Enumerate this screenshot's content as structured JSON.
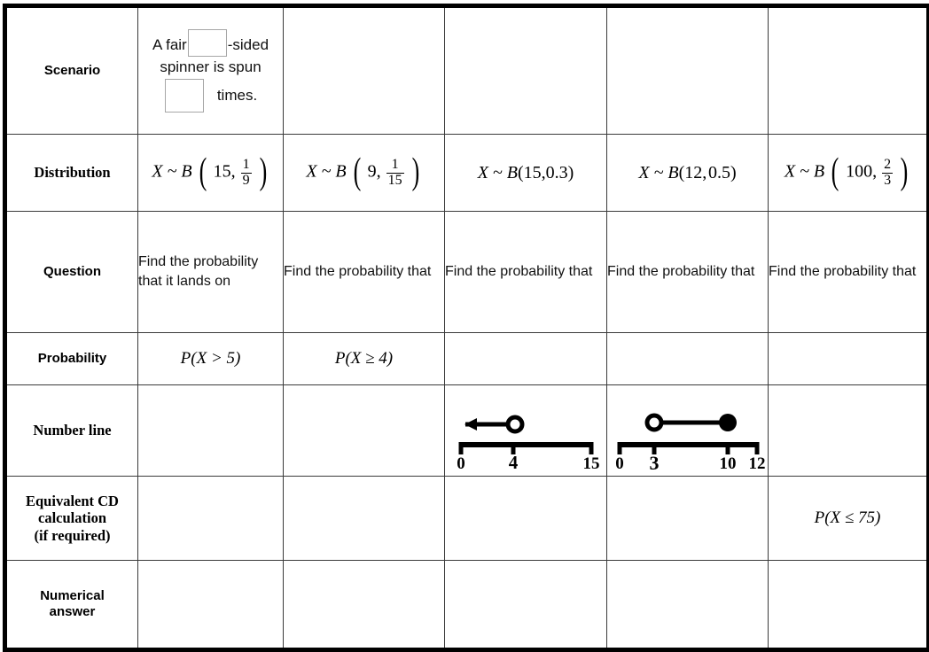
{
  "worksheet": {
    "row_headers": [
      "Scenario",
      "Distribution",
      "Question",
      "Probability",
      "Number line",
      "Equivalent CD calculation (if required)",
      "Numerical answer"
    ],
    "row_header_lines": {
      "equivalent_cd": [
        "Equivalent CD",
        "calculation",
        "(if required)"
      ],
      "numerical_answer": [
        "Numerical",
        "answer"
      ]
    },
    "colors": {
      "header_fill": "#d9d9d9",
      "border_heavy": "#000000",
      "border_light": "#3a3a3a",
      "input_box_border": "#a6a6a6",
      "text": "#000000"
    }
  },
  "columns": [
    {
      "id": "col1",
      "scenario": {
        "text_before_blank": "A fair",
        "text_after_blank": "-sided",
        "line2": "spinner is spun",
        "text_after_blank2": "times.",
        "blank1_value": "",
        "blank2_value": ""
      },
      "distribution": {
        "lhs": "X ~ B",
        "n": "15",
        "p_numerator": "1",
        "p_denominator": "9",
        "p_is_fraction": true,
        "full_text": "X ~ B(15, 1/9)"
      },
      "question": "Find the probability that it lands on",
      "probability": "P(X > 5)",
      "number_line": null,
      "equivalent_cd": "",
      "numerical_answer": ""
    },
    {
      "id": "col2",
      "scenario": {
        "empty": true
      },
      "distribution": {
        "lhs": "X ~ B",
        "n": "9",
        "p_numerator": "1",
        "p_denominator": "15",
        "p_is_fraction": true,
        "full_text": "X ~ B(9, 1/15)"
      },
      "question": "Find the probability that",
      "probability": "P(X ≥ 4)",
      "number_line": null,
      "equivalent_cd": "",
      "numerical_answer": ""
    },
    {
      "id": "col3",
      "scenario": {
        "empty": true
      },
      "distribution": {
        "lhs": "X ~ B",
        "n": "15",
        "p": "0.3",
        "p_is_fraction": false,
        "full_text": "X ~ B(15,0.3)"
      },
      "question": "Find the probability that",
      "probability": "",
      "number_line": {
        "axis_min_label": "0",
        "axis_max_label": "15",
        "ticks": [
          "0",
          "4",
          "15"
        ],
        "tick_positions": [
          0,
          4,
          15
        ],
        "marker_value": 4,
        "marker_type": "open",
        "direction": "left",
        "has_second_marker": false
      },
      "equivalent_cd": "",
      "numerical_answer": ""
    },
    {
      "id": "col4",
      "scenario": {
        "empty": true
      },
      "distribution": {
        "lhs": "X ~ B",
        "n": "12",
        "p": "0.5",
        "p_is_fraction": false,
        "full_text": "X ~ B(12, 0.5)"
      },
      "question": "Find the probability that",
      "probability": "",
      "number_line": {
        "axis_min_label": "0",
        "axis_max_label": "12",
        "ticks": [
          "0",
          "3",
          "10",
          "12"
        ],
        "tick_positions": [
          0,
          3,
          10,
          12
        ],
        "marker_value": 3,
        "marker_type": "open",
        "second_marker_value": 10,
        "second_marker_type": "closed",
        "direction": "segment",
        "has_second_marker": true
      },
      "equivalent_cd": "",
      "numerical_answer": ""
    },
    {
      "id": "col5",
      "scenario": {
        "empty": true
      },
      "distribution": {
        "lhs": "X ~ B",
        "n": "100",
        "p_numerator": "2",
        "p_denominator": "3",
        "p_is_fraction": true,
        "full_text": "X ~ B(100, 2/3)"
      },
      "question": "Find the probability that",
      "probability": "",
      "number_line": null,
      "equivalent_cd": "P(X ≤ 75)",
      "numerical_answer": ""
    }
  ]
}
